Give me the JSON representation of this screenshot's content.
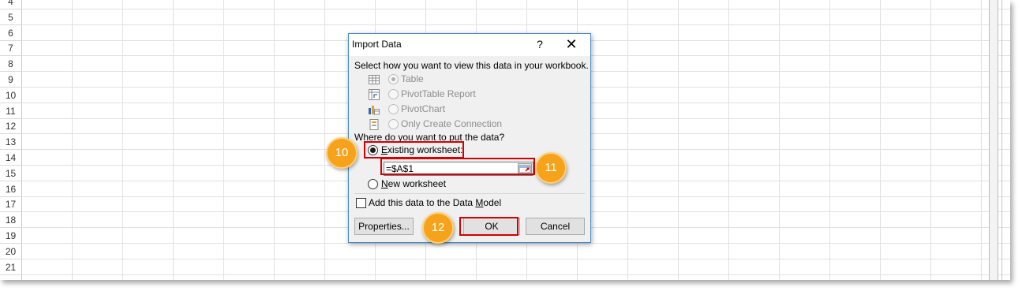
{
  "rows": [
    "4",
    "5",
    "6",
    "7",
    "8",
    "9",
    "10",
    "11",
    "12",
    "13",
    "14",
    "15",
    "16",
    "17",
    "18",
    "19",
    "20",
    "21"
  ],
  "dialog": {
    "title": "Import Data",
    "help": "?",
    "close": "✕",
    "prompt": "Select how you want to view this data in your workbook.",
    "view_options": [
      {
        "label": "Table",
        "icon": "table-icon",
        "selected": true
      },
      {
        "label": "PivotTable Report",
        "icon": "pivottable-icon",
        "selected": false
      },
      {
        "label": "PivotChart",
        "icon": "pivotchart-icon",
        "selected": false
      },
      {
        "label": "Only Create Connection",
        "icon": "connection-icon",
        "selected": false
      }
    ],
    "where_label": "Where do you want to put the data?",
    "existing_worksheet": {
      "prefix": "E",
      "rest": "xisting worksheet:",
      "selected": true
    },
    "range_value": "=$A$1",
    "new_worksheet": {
      "prefix": "N",
      "rest": "ew worksheet",
      "selected": false
    },
    "data_model": {
      "before": "Add this data to the Data ",
      "underline": "M",
      "after": "odel",
      "checked": false
    },
    "properties_button": "Properties...",
    "properties_underline": "r",
    "ok_button": "OK",
    "cancel_button": "Cancel"
  },
  "callouts": [
    "10",
    "11",
    "12"
  ],
  "colors": {
    "highlight": "#d40000",
    "badge": "#f6a21a",
    "dialog_border": "#4a8ac7"
  }
}
